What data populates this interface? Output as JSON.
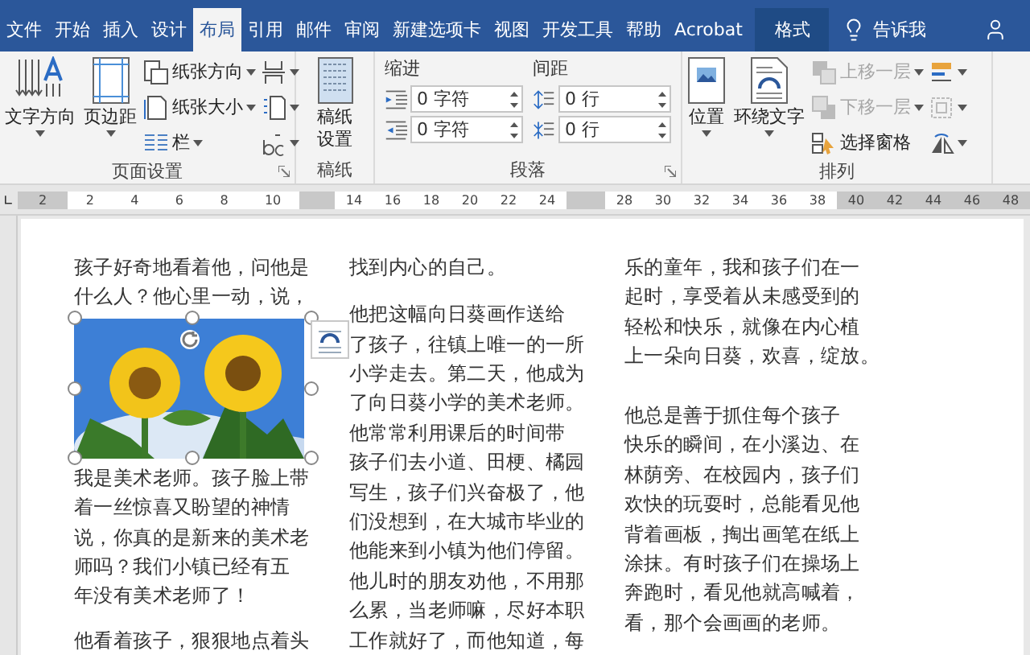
{
  "tabs": [
    {
      "label": "文件",
      "selected": false,
      "kind": "plain"
    },
    {
      "label": "开始",
      "selected": false,
      "kind": "plain"
    },
    {
      "label": "插入",
      "selected": false,
      "kind": "plain"
    },
    {
      "label": "设计",
      "selected": false,
      "kind": "plain"
    },
    {
      "label": "布局",
      "selected": true,
      "kind": "plain"
    },
    {
      "label": "引用",
      "selected": false,
      "kind": "plain"
    },
    {
      "label": "邮件",
      "selected": false,
      "kind": "plain"
    },
    {
      "label": "审阅",
      "selected": false,
      "kind": "plain"
    },
    {
      "label": "新建选项卡",
      "selected": false,
      "kind": "plain"
    },
    {
      "label": "视图",
      "selected": false,
      "kind": "plain"
    },
    {
      "label": "开发工具",
      "selected": false,
      "kind": "plain"
    },
    {
      "label": "帮助",
      "selected": false,
      "kind": "plain"
    },
    {
      "label": "Acrobat",
      "selected": false,
      "kind": "plain"
    },
    {
      "label": "格式",
      "selected": false,
      "kind": "contextual"
    }
  ],
  "tell_me": "告诉我",
  "page_setup": {
    "title": "页面设置",
    "launcher": true,
    "big": [
      {
        "kind": "text-direction",
        "label": "文字方向"
      },
      {
        "kind": "margins",
        "label": "页边距"
      }
    ],
    "small": [
      {
        "kind": "orientation",
        "label": "纸张方向"
      },
      {
        "kind": "size",
        "label": "纸张大小"
      },
      {
        "kind": "columns",
        "label": "栏"
      }
    ]
  },
  "manuscript": {
    "title": "稿纸",
    "button": "稿纸设置"
  },
  "paragraph": {
    "title": "段落",
    "launcher": true,
    "indent": {
      "label": "缩进",
      "fields": [
        {
          "kind": "left",
          "value": "0 字符"
        },
        {
          "kind": "right",
          "value": "0 字符"
        }
      ]
    },
    "spacing": {
      "label": "间距",
      "fields": [
        {
          "kind": "before",
          "value": "0 行"
        },
        {
          "kind": "after",
          "value": "0 行"
        }
      ]
    }
  },
  "arrange": {
    "title": "排列",
    "big": [
      {
        "kind": "position",
        "label": "位置"
      },
      {
        "kind": "wrap",
        "label": "环绕文字"
      }
    ],
    "small": [
      {
        "kind": "forward",
        "label": "上移一层",
        "disabled": true
      },
      {
        "kind": "backward",
        "label": "下移一层",
        "disabled": true
      },
      {
        "kind": "pane",
        "label": "选择窗格",
        "disabled": false
      }
    ]
  },
  "ruler": [
    {
      "kind": "margin",
      "labels": [
        "2"
      ]
    },
    {
      "kind": "text",
      "labels": [
        "2",
        "4",
        "6",
        "8",
        "10"
      ]
    },
    {
      "kind": "gap"
    },
    {
      "kind": "text",
      "labels": [
        "14",
        "16",
        "18",
        "20",
        "22",
        "24"
      ]
    },
    {
      "kind": "gap"
    },
    {
      "kind": "text",
      "labels": [
        "28",
        "30",
        "32",
        "34",
        "36",
        "38"
      ]
    },
    {
      "kind": "margin",
      "labels": [
        "40",
        "42",
        "44",
        "46",
        "48"
      ]
    }
  ],
  "columns": [
    {
      "items": [
        {
          "kind": "line",
          "text": "孩子好奇地看着他，问他是"
        },
        {
          "kind": "line",
          "text": "什么人？他心里一动，说，"
        },
        {
          "kind": "picture",
          "selected": true
        },
        {
          "kind": "line",
          "text": "我是美术老师。孩子脸上带"
        },
        {
          "kind": "line",
          "text": "着一丝惊喜又盼望的神情"
        },
        {
          "kind": "line",
          "text": "说，你真的是新来的美术老"
        },
        {
          "kind": "line",
          "text": "师吗？我们小镇已经有五"
        },
        {
          "kind": "line",
          "text": "年没有美术老师了！"
        },
        {
          "kind": "blank"
        },
        {
          "kind": "line",
          "text": "他看着孩子，狠狠地点着头"
        }
      ]
    },
    {
      "items": [
        {
          "kind": "line",
          "text": "找到内心的自己。"
        },
        {
          "kind": "blank"
        },
        {
          "kind": "line",
          "text": "他把这幅向日葵画作送给"
        },
        {
          "kind": "line",
          "text": "了孩子，往镇上唯一的一所"
        },
        {
          "kind": "line",
          "text": "小学走去。第二天，他成为"
        },
        {
          "kind": "line",
          "text": "了向日葵小学的美术老师。"
        },
        {
          "kind": "line",
          "text": "他常常利用课后的时间带"
        },
        {
          "kind": "line",
          "text": "孩子们去小道、田梗、橘园"
        },
        {
          "kind": "line",
          "text": "写生，孩子们兴奋极了，他"
        },
        {
          "kind": "line",
          "text": "们没想到，在大城市毕业的"
        },
        {
          "kind": "line",
          "text": "他能来到小镇为他们停留。"
        },
        {
          "kind": "line",
          "text": "他儿时的朋友劝他，不用那"
        },
        {
          "kind": "line",
          "text": "么累，当老师嘛，尽好本职"
        },
        {
          "kind": "line",
          "text": "工作就好了，而他知道，每"
        }
      ]
    },
    {
      "items": [
        {
          "kind": "line",
          "text": "乐的童年，我和孩子们在一"
        },
        {
          "kind": "line",
          "text": "起时，享受着从未感受到的"
        },
        {
          "kind": "line",
          "text": "轻松和快乐，就像在内心植"
        },
        {
          "kind": "line",
          "text": "上一朵向日葵，欢喜，绽放。"
        },
        {
          "kind": "blank"
        },
        {
          "kind": "line",
          "text": "他总是善于抓住每个孩子"
        },
        {
          "kind": "line",
          "text": "快乐的瞬间，在小溪边、在"
        },
        {
          "kind": "line",
          "text": "林荫旁、在校园内，孩子们"
        },
        {
          "kind": "line",
          "text": "欢快的玩耍时，总能看见他"
        },
        {
          "kind": "line",
          "text": "背着画板，掏出画笔在纸上"
        },
        {
          "kind": "line",
          "text": "涂抹。有时孩子们在操场上"
        },
        {
          "kind": "line",
          "text": "奔跑时，看见他就高喊着，"
        },
        {
          "kind": "line",
          "text": "看，那个会画画的老师。"
        }
      ]
    }
  ]
}
